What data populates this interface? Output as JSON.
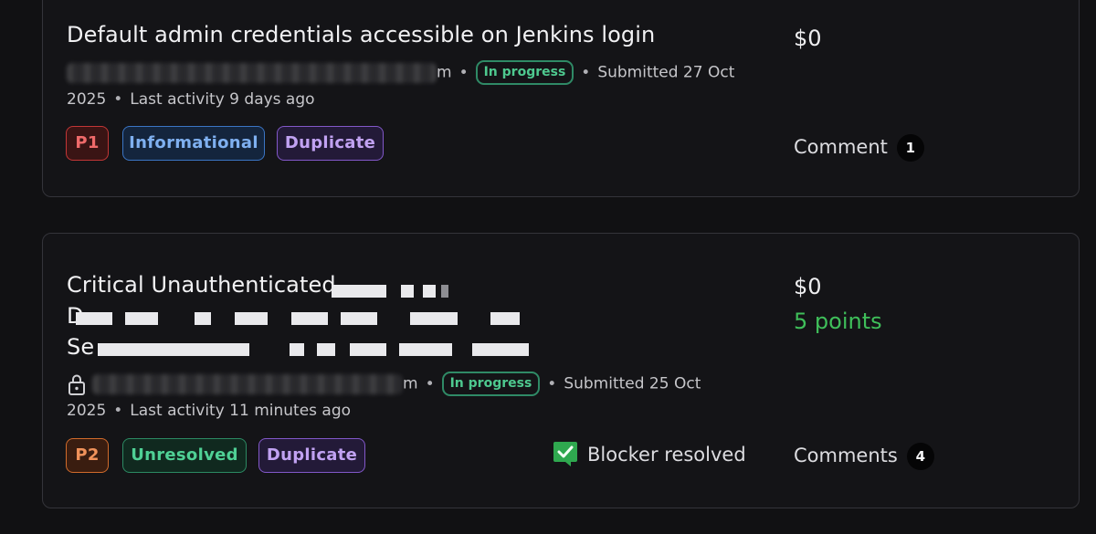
{
  "reports": [
    {
      "title": "Default admin credentials accessible on Jenkins login",
      "meta_suffix": "m",
      "status": "In progress",
      "submitted_line1": "Submitted 27 Oct",
      "submitted_line2": "2025",
      "last_activity": "Last activity 9 days ago",
      "tags": [
        "P1",
        "Informational",
        "Duplicate"
      ],
      "bounty": "$0",
      "comment_label": "Comment",
      "comment_count": "1"
    },
    {
      "title_line1": "Critical Unauthenticated",
      "title_line2_start": "D",
      "title_line3_start": "Se",
      "meta_suffix": "m",
      "status": "In progress",
      "submitted_line1": "Submitted 25 Oct",
      "submitted_line2": "2025",
      "last_activity": "Last activity 11 minutes ago",
      "tags": [
        "P2",
        "Unresolved",
        "Duplicate"
      ],
      "blocker": "Blocker resolved",
      "bounty": "$0",
      "points": "5 points",
      "comment_label": "Comments",
      "comment_count": "4"
    }
  ],
  "icons": {
    "lock": "lock-icon",
    "blocker": "check-icon"
  },
  "colors": {
    "background": "#111113",
    "card": "#141417",
    "status_green": "#4ec98f",
    "points_green": "#3fbf5a"
  }
}
